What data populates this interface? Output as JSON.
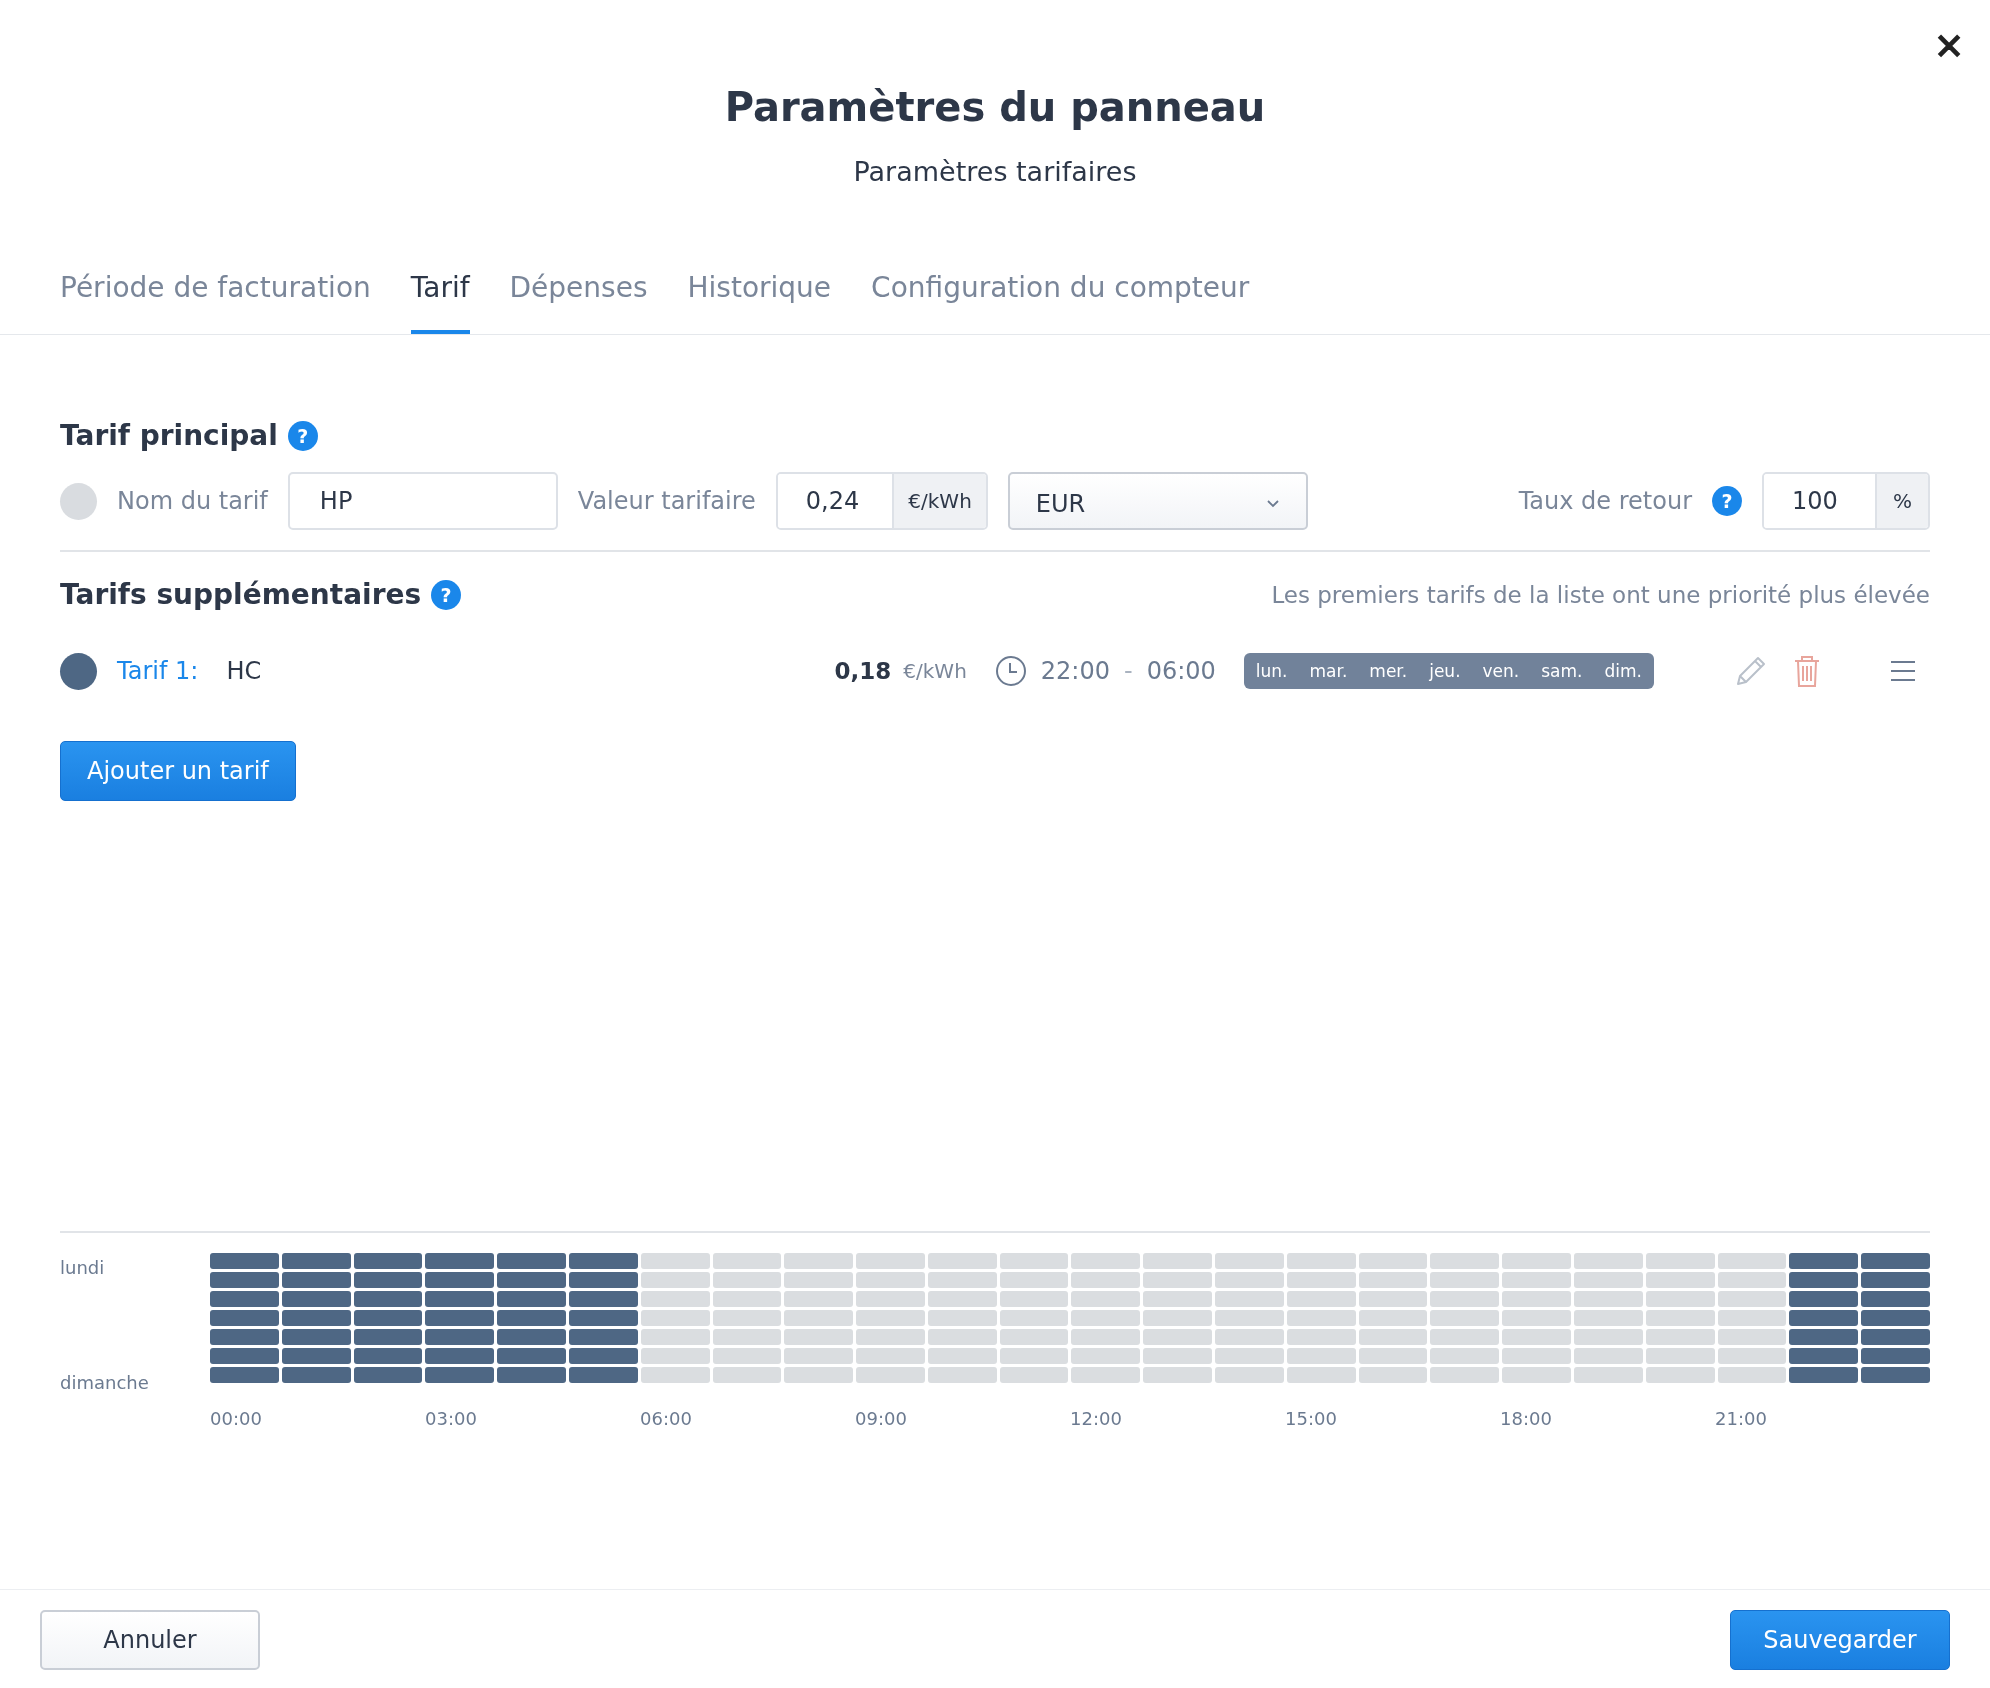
{
  "dialog": {
    "title": "Paramètres du panneau",
    "subtitle": "Paramètres tarifaires",
    "close": "✕"
  },
  "tabs": [
    {
      "label": "Période de facturation",
      "selected": false
    },
    {
      "label": "Tarif",
      "selected": true
    },
    {
      "label": "Dépenses",
      "selected": false
    },
    {
      "label": "Historique",
      "selected": false
    },
    {
      "label": "Configuration du compteur",
      "selected": false
    }
  ],
  "main_tariff": {
    "heading": "Tarif principal",
    "help": "?",
    "color": "#d9dce0",
    "name_label": "Nom du tarif",
    "name_value": "HP",
    "value_label": "Valeur tarifaire",
    "value": "0,24",
    "unit": "€/kWh",
    "currency": "EUR",
    "return_label": "Taux de retour",
    "return_help": "?",
    "return_value": "100",
    "return_unit": "%"
  },
  "additional": {
    "heading": "Tarifs supplémentaires",
    "help": "?",
    "note": "Les premiers tarifs de la liste ont une priorité plus élevée",
    "tariffs": [
      {
        "label": "Tarif 1:",
        "name": "HC",
        "color": "#4e6784",
        "price": "0,18",
        "unit": "€/kWh",
        "start": "22:00",
        "separator": "-",
        "end": "06:00",
        "days": [
          "lun.",
          "mar.",
          "mer.",
          "jeu.",
          "ven.",
          "sam.",
          "dim."
        ]
      }
    ],
    "add_button": "Ajouter un tarif"
  },
  "schedule": {
    "first_day": "lundi",
    "last_day": "dimanche",
    "hours": [
      "00:00",
      "03:00",
      "06:00",
      "09:00",
      "12:00",
      "15:00",
      "18:00",
      "21:00"
    ],
    "rows": [
      {
        "cells": [
          true,
          true,
          true,
          true,
          true,
          true,
          false,
          false,
          false,
          false,
          false,
          false,
          false,
          false,
          false,
          false,
          false,
          false,
          false,
          false,
          false,
          false,
          true,
          true
        ]
      },
      {
        "cells": [
          true,
          true,
          true,
          true,
          true,
          true,
          false,
          false,
          false,
          false,
          false,
          false,
          false,
          false,
          false,
          false,
          false,
          false,
          false,
          false,
          false,
          false,
          true,
          true
        ]
      },
      {
        "cells": [
          true,
          true,
          true,
          true,
          true,
          true,
          false,
          false,
          false,
          false,
          false,
          false,
          false,
          false,
          false,
          false,
          false,
          false,
          false,
          false,
          false,
          false,
          true,
          true
        ]
      },
      {
        "cells": [
          true,
          true,
          true,
          true,
          true,
          true,
          false,
          false,
          false,
          false,
          false,
          false,
          false,
          false,
          false,
          false,
          false,
          false,
          false,
          false,
          false,
          false,
          true,
          true
        ]
      },
      {
        "cells": [
          true,
          true,
          true,
          true,
          true,
          true,
          false,
          false,
          false,
          false,
          false,
          false,
          false,
          false,
          false,
          false,
          false,
          false,
          false,
          false,
          false,
          false,
          true,
          true
        ]
      },
      {
        "cells": [
          true,
          true,
          true,
          true,
          true,
          true,
          false,
          false,
          false,
          false,
          false,
          false,
          false,
          false,
          false,
          false,
          false,
          false,
          false,
          false,
          false,
          false,
          true,
          true
        ]
      },
      {
        "cells": [
          true,
          true,
          true,
          true,
          true,
          true,
          false,
          false,
          false,
          false,
          false,
          false,
          false,
          false,
          false,
          false,
          false,
          false,
          false,
          false,
          false,
          false,
          true,
          true
        ]
      }
    ]
  },
  "footer": {
    "cancel": "Annuler",
    "save": "Sauvegarder"
  }
}
